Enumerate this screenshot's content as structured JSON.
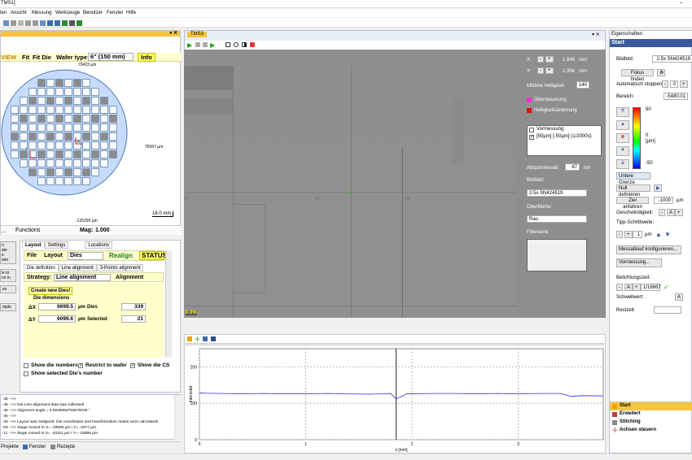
{
  "window": {
    "title": "TMS1]",
    "minimize": "–"
  },
  "menu": [
    "ten",
    "Ansicht",
    "Messung",
    "Werkzeuge",
    "Benutzer",
    "Fenster",
    "Hilfe"
  ],
  "wafer_panel": {
    "pin": "♦ ✕",
    "view_label": "VIEW",
    "fit": "Fit",
    "fit_die": "Fit Die",
    "wafer_type_label": "Wafer type:",
    "wafer_type_value": "6\" (150 mm)",
    "info": "Info",
    "top_dim": "79423 µm",
    "right_dim": "78367 µm",
    "bottom_dim": "-125299 µm",
    "scale": "16.0 mm",
    "axis_y": "Y",
    "axis_x": "X",
    "functions": "Functions",
    "mag_label": "Mag:",
    "mag_value": "1.000",
    "dots": "..."
  },
  "left_side_buttons": [
    "n\nate\ne\nster",
    "le to\non in",
    "es",
    "mple"
  ],
  "layout_panel": {
    "tabs": [
      "Layout",
      "Settings",
      "Locations"
    ],
    "file": "File",
    "layout": "Layout",
    "dies": "Dies",
    "realign": "Realign",
    "status": "STATUS",
    "subtabs": [
      "Die definition",
      "Line alignment",
      "3-Points alignment"
    ],
    "strategy_label": "Strategy:",
    "strategy_value": "Line alignment",
    "alignment": "Alignment",
    "create_new": "Create new Dies!",
    "die_dimensions": "Die dimensions",
    "dx_label": "ΔX",
    "dx_value": "6699.5",
    "dy_label": "ΔY",
    "dy_value": "6099.6",
    "unit": "µm",
    "dies_label": "Dies",
    "dies_value": "339",
    "selected_label": "Selected",
    "selected_value": "21",
    "show_numbers": "Show die numbers",
    "restrict": "Restrict to wafer",
    "show_cs": "Show die CS",
    "show_selected": "Show selected Die's number"
  },
  "log": [
    ":45 -->>",
    ":45 -->> Die-Line alignment data was collected!",
    ":45 -->> Alignment angle = 0.0835993763670025 °",
    ":45 -->>",
    ":45 -->> Layout was realigned. Die coordinates and transformation matrix were calculated!",
    ":03 -->> Stage moved to X= -29930 µm / Y= -3377 µm",
    ":11 -->> Stage moved to X= -43311 µm / Y= -15556 µm"
  ],
  "bottom_tabs": [
    "Projekte",
    "Fenster",
    "Rezepte"
  ],
  "doc_tab": {
    "title": "TMS3",
    "close": "▾ ✕"
  },
  "image": {
    "overlay": "0.0%",
    "labels": [
      "2H",
      "2H",
      "2H"
    ]
  },
  "measure_panel": {
    "x_label": "X:",
    "x_value": "1.848",
    "y_label": "Y:",
    "y_value": "1.394",
    "mm": "mm",
    "brightness_label": "Mittlere Helligkeit:",
    "brightness_value": "140",
    "legend1": "Übersteuerung",
    "legend2": "Helligkeitsänderung",
    "list_items": [
      "Vormessung",
      "[50µm] [-50µm] (1/2000s)"
    ],
    "interval_label": "Abtastintervall:",
    "interval_value": "87",
    "nm": "nm",
    "bildfeld_label": "Bildfeld:",
    "bildfeld_value": "2.5x SN424519",
    "surface_label": "Oberfläche:",
    "surface_value": "Rau",
    "filter_label": "Filterserie:"
  },
  "chart_data": {
    "type": "line",
    "xlabel": "x [mm]",
    "ylabel": "Intensität",
    "xlim": [
      0,
      3.8
    ],
    "ylim": [
      0,
      250
    ],
    "xticks": [
      "0",
      "1",
      "2",
      "3"
    ],
    "yticks": [
      "0",
      "100",
      "200"
    ],
    "cursor_x": 1.85,
    "series": [
      {
        "color": "#2b2bd6",
        "x": [
          0,
          0.2,
          0.4,
          0.6,
          0.8,
          1.0,
          1.2,
          1.4,
          1.6,
          1.8,
          1.85,
          1.95,
          2.2,
          2.4,
          2.6,
          2.8,
          3.0,
          3.2,
          3.4,
          3.5,
          3.6,
          3.8
        ],
        "y": [
          128,
          127,
          126,
          127,
          126,
          126,
          127,
          126,
          125,
          127,
          112,
          126,
          127,
          127,
          126,
          127,
          126,
          127,
          127,
          119,
          121,
          120
        ]
      }
    ]
  },
  "props": {
    "title": "Eigenschaften",
    "section": "Start",
    "bildfeld_label": "Bildfeld:",
    "bildfeld_value": "2.5x SN424519",
    "focus": "Fokus finden",
    "autostop": "Automatisch stoppen:",
    "range_label": "Bereich:",
    "range_value": "-5480.01",
    "scale_top": "50",
    "scale_mid": "0",
    "scale_unit": "[µm]",
    "scale_bottom": "-50",
    "lower_limit": "Untere Grenze",
    "null_def": "Null definieren",
    "target": "Ziel anfahren",
    "target_value": "-1000",
    "target_unit": "µm",
    "speed": "Geschwindigkeit:",
    "tip_width": "Tipp-Schrittweite:",
    "tip_value": "1",
    "tip_unit": "µm",
    "configure": "Messablauf konfigurieren...",
    "premeasure": "Vormessung...",
    "exposure": "Belichtungszeit:",
    "exposure_value": "1/16667",
    "threshold": "Schwellwert:",
    "rest": "Restzeit:",
    "nav": [
      "Start",
      "Erweitert",
      "Stitching",
      "Achsen steuern"
    ]
  }
}
